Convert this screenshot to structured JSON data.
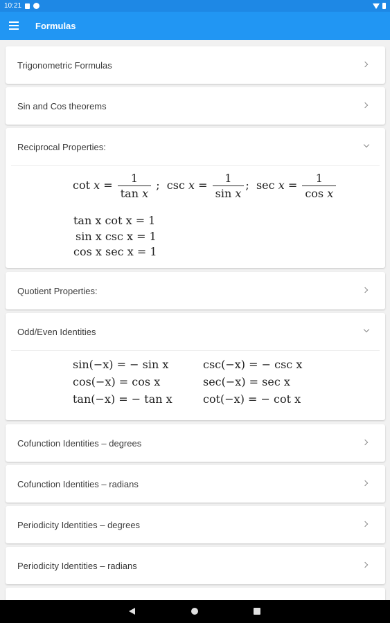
{
  "status_bar": {
    "time": "10:21"
  },
  "app_bar": {
    "title": "Formulas"
  },
  "sections": [
    {
      "title": "Trigonometric Formulas",
      "expanded": false
    },
    {
      "title": "Sin and Cos theorems",
      "expanded": false
    },
    {
      "title": "Reciprocal Properties:",
      "expanded": true
    },
    {
      "title": "Quotient Properties:",
      "expanded": false
    },
    {
      "title": "Odd/Even Identities",
      "expanded": true
    },
    {
      "title": "Cofunction Identities – degrees",
      "expanded": false
    },
    {
      "title": "Cofunction Identities – radians",
      "expanded": false
    },
    {
      "title": "Periodicity Identities – degrees",
      "expanded": false
    },
    {
      "title": "Periodicity Identities – radians",
      "expanded": false
    }
  ],
  "reciprocal": {
    "numerator": "1",
    "tan_den": "tan",
    "sin_den": "sin",
    "cos_den": "cos",
    "var": "x",
    "separator": ";",
    "line1": "tan x cot x = 1",
    "line2": "sin x csc x = 1",
    "line3": "cos x sec x = 1"
  },
  "odd_even": {
    "left": [
      "sin(−x) = − sin x",
      "cos(−x) = cos x",
      "tan(−x) = − tan x"
    ],
    "right": [
      "csc(−x) = − csc x",
      "sec(−x) = sec x",
      "cot(−x) = − cot x"
    ]
  },
  "colors": {
    "app_bar": "#2196f3",
    "status_bar": "#1e88e5",
    "background": "#f1f1f1"
  }
}
